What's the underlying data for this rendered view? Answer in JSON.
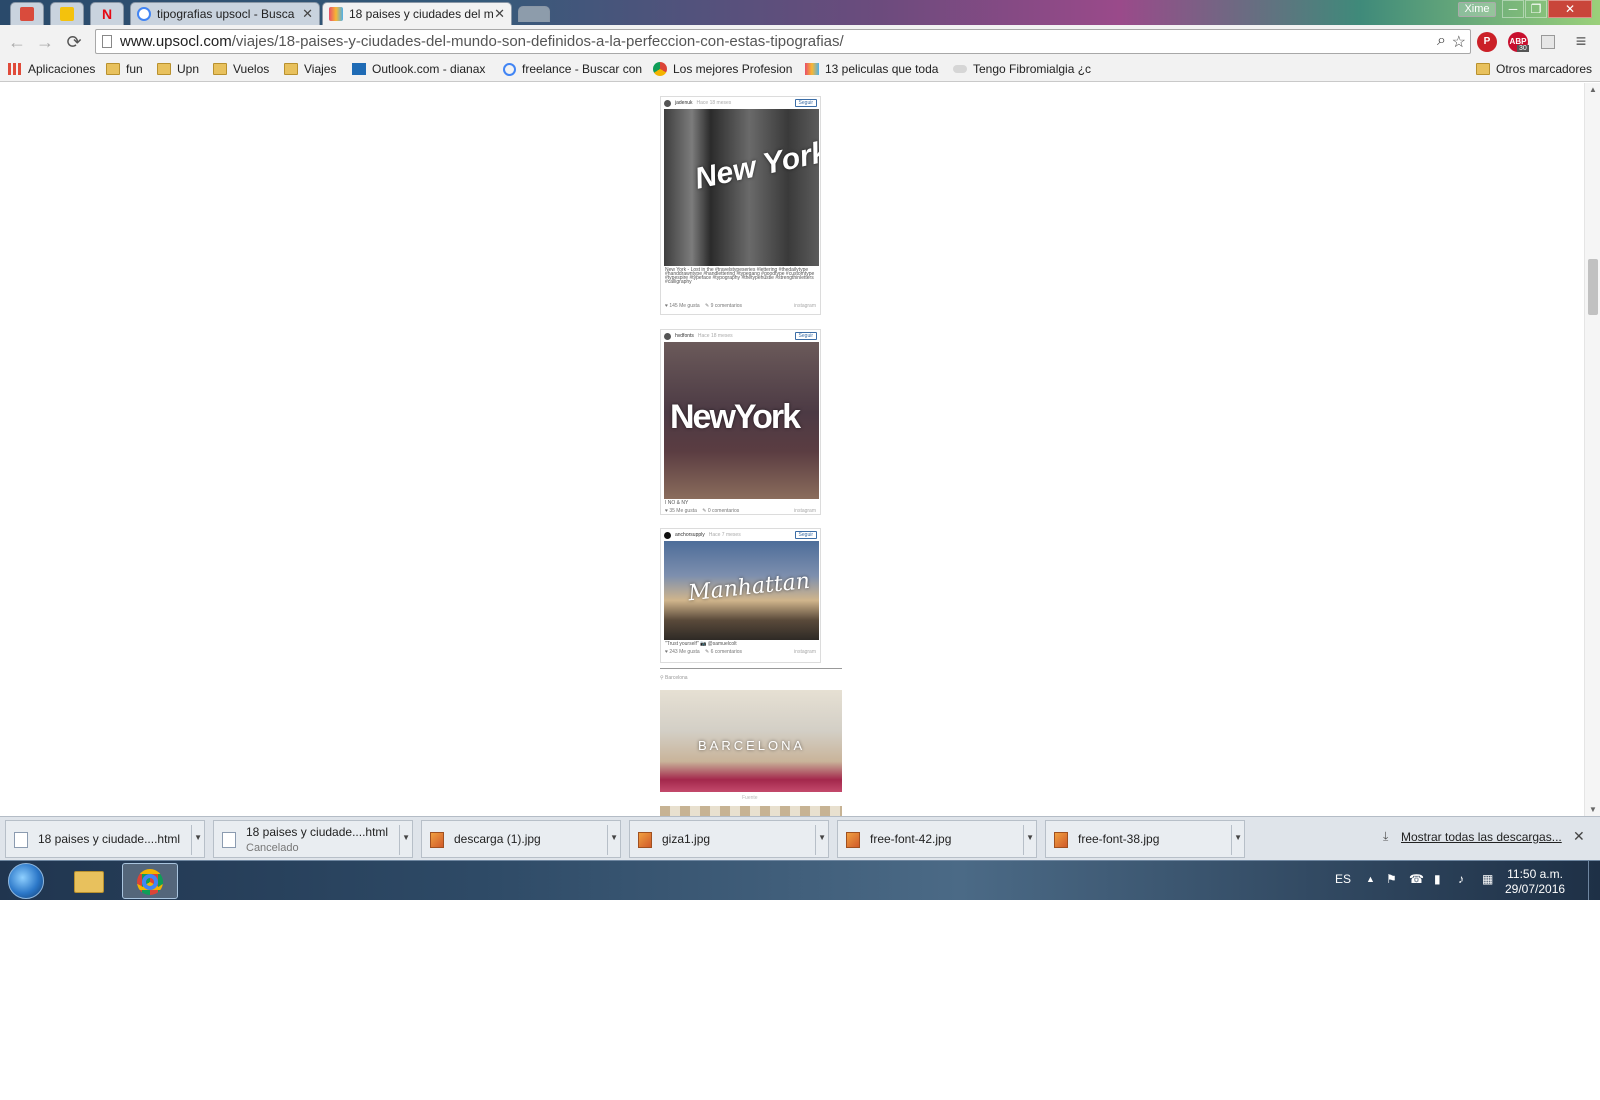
{
  "browser": {
    "tabs": [
      {
        "label": "tipografias upsocl - Busca"
      },
      {
        "label": "18 paises y ciudades del m"
      }
    ],
    "close_glyph": "✕",
    "user_badge": "Xime",
    "window_buttons": {
      "minimize": "─",
      "restore": "❐",
      "close": "✕"
    },
    "url_domain": "www.upsocl.com",
    "url_path": "/viajes/18-paises-y-ciudades-del-mundo-son-definidos-a-la-perfeccion-con-estas-tipografias/",
    "extensions": {
      "abp": "ABP",
      "abp_count": "30"
    },
    "icons": {
      "back": "←",
      "forward": "→",
      "reload": "⟳",
      "search": "⌕",
      "star": "☆",
      "menu": "≡",
      "pinterest": "P"
    }
  },
  "bookmarks": {
    "items": [
      {
        "label": "Aplicaciones"
      },
      {
        "label": "fun"
      },
      {
        "label": "Upn"
      },
      {
        "label": "Vuelos"
      },
      {
        "label": "Viajes"
      },
      {
        "label": "Outlook.com - dianax"
      },
      {
        "label": "freelance - Buscar con"
      },
      {
        "label": "Los mejores Profesion"
      },
      {
        "label": "13 peliculas que toda"
      },
      {
        "label": "Tengo Fibromialgia ¿c"
      }
    ],
    "other": "Otros marcadores"
  },
  "posts": [
    {
      "user": "jadenuk",
      "ago": "Hace 18 meses",
      "follow": "Seguir",
      "photo_text": "New York",
      "caption": "New York - Lost in the #travelstypeseries #lettering #thedailytype #handdrawntype #handlettering #typegang #goodtype #customtype #typespire #typeface #typography #thetypehustle #strengthinletters #calligraphy",
      "likes": "♥ 145 Me gusta",
      "comments": "✎ 9 comentarios",
      "brand": "instagram"
    },
    {
      "user": "hvdfonts",
      "ago": "Hace 18 meses",
      "follow": "Seguir",
      "photo_text": "NewYork",
      "caption": "I NO & NY",
      "likes": "♥ 35 Me gusta",
      "comments": "✎ 0 comentarios",
      "brand": "instagram"
    },
    {
      "user": "anchorsupply",
      "ago": "Hace 7 meses",
      "follow": "Seguir",
      "photo_text": "Manhattan",
      "caption": "\"Trust yourself\" 📷 @samuelcolt",
      "likes": "♥ 243 Me gusta",
      "comments": "✎ 6 comentarios",
      "brand": "instagram"
    }
  ],
  "location": {
    "label": "⚲ Barcelona",
    "photo_text": "BARCELONA",
    "credit": "Fuente"
  },
  "downloads": {
    "items": [
      {
        "name": "18 paises y ciudade....html",
        "status": ""
      },
      {
        "name": "18 paises y ciudade....html",
        "status": "Cancelado"
      },
      {
        "name": "descarga (1).jpg",
        "status": ""
      },
      {
        "name": "giza1.jpg",
        "status": ""
      },
      {
        "name": "free-font-42.jpg",
        "status": ""
      },
      {
        "name": "free-font-38.jpg",
        "status": ""
      }
    ],
    "show_all": "Mostrar todas las descargas...",
    "close": "✕"
  },
  "taskbar": {
    "lang": "ES",
    "time": "11:50 a.m.",
    "date": "29/07/2016",
    "tray_icons": [
      "▲",
      "⚑",
      "☎",
      "▮",
      "♪",
      "▦"
    ]
  }
}
